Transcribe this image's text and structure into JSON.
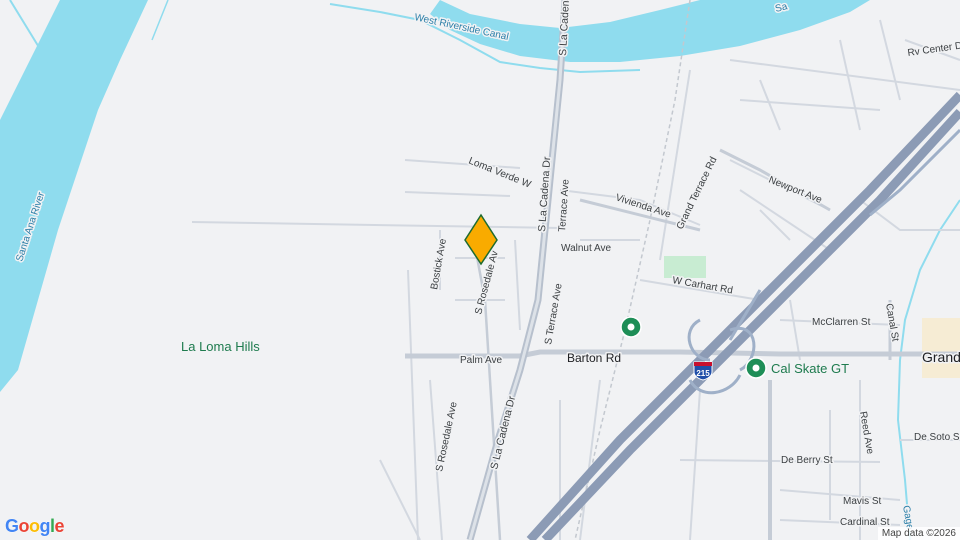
{
  "water": {
    "river_label": "Santa Ana River",
    "river_label_top": "Sa",
    "canal_label": "West Riverside Canal",
    "gage_label": "Gage"
  },
  "areas": {
    "hills_label": "La Loma Hills",
    "town_label": "Grand"
  },
  "roads": {
    "la_cadena_upper": "S La Cadena Dr",
    "la_cadena_mid": "S La Cadena Dr",
    "la_cadena_lower": "S La Cadena Dr",
    "loma_verde": "Loma Verde W",
    "terrace_ave": "Terrace Ave",
    "s_terrace_ave": "S Terrace Ave",
    "bostick_ave": "Bostick Ave",
    "s_rosedale_upper": "S Rosedale Av",
    "s_rosedale_lower": "S Rosedale Ave",
    "vivienda_ave": "Vivienda Ave",
    "walnut_ave": "Walnut Ave",
    "grand_terrace_rd": "Grand Terrace Rd",
    "newport_ave": "Newport Ave",
    "w_carhart_rd": "W Carhart Rd",
    "mcclarren_st": "McClarren St",
    "canal_st": "Canal St",
    "palm_ave": "Palm Ave",
    "barton_rd": "Barton Rd",
    "rv_center_dr": "Rv Center D",
    "reed_ave": "Reed Ave",
    "de_soto_st": "De Soto S",
    "de_berry_st": "De Berry St",
    "mavis_st": "Mavis St",
    "cardinal_st": "Cardinal St",
    "interstate_shield": "215"
  },
  "pois": {
    "cal_skate": "Cal Skate GT"
  },
  "branding": {
    "logo": "Google",
    "attribution": "Map data ©2026"
  },
  "colors": {
    "background": "#f1f2f4",
    "water": "#8fdcee",
    "highway": "#8c9bb5",
    "major_road": "#c5ccd6",
    "minor_road": "#d7dce3",
    "marker": "#f9ab00",
    "marker_outline": "#1e6b2f",
    "poi_green": "#1e8e57"
  }
}
